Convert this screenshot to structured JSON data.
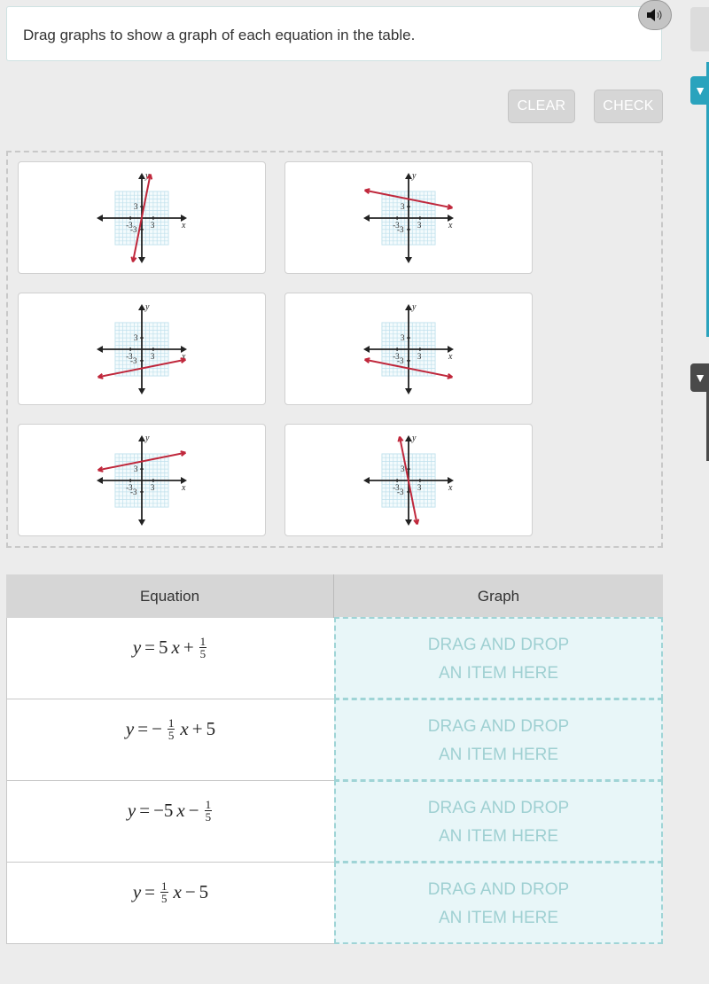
{
  "prompt": {
    "text": "Drag graphs to show a graph of each equation in the table.",
    "audio_icon": "speaker-icon"
  },
  "toolbar": {
    "clear_label": "CLEAR",
    "check_label": "CHECK"
  },
  "side_tabs": {
    "teal_icon": "▼",
    "dark_icon": "▼"
  },
  "colors": {
    "accent_teal": "#2aa3bd",
    "line_red": "#c0283c",
    "grid_blue": "#bfe0ec",
    "drop_bg": "#e8f6f8",
    "drop_text": "#9fd0d2"
  },
  "graph_axis": {
    "x_label": "x",
    "y_label": "y",
    "tick_pos": "3",
    "tick_neg": "-3"
  },
  "graph_cards": [
    {
      "id": "graph-1",
      "slope": 5,
      "intercept": 0.2
    },
    {
      "id": "graph-2",
      "slope": -0.2,
      "intercept": 5
    },
    {
      "id": "graph-3",
      "slope": 0.2,
      "intercept": -5
    },
    {
      "id": "graph-4",
      "slope": -0.2,
      "intercept": -5
    },
    {
      "id": "graph-5",
      "slope": 0.2,
      "intercept": 5
    },
    {
      "id": "graph-6",
      "slope": -5,
      "intercept": -0.2
    }
  ],
  "table": {
    "headers": [
      "Equation",
      "Graph"
    ],
    "rows": [
      {
        "lhs": "y",
        "eq": "=",
        "pre": "5",
        "var": "x",
        "op": "+",
        "frac_sign": "",
        "frac_num": "1",
        "frac_den": "5",
        "frac_first": false,
        "tail": ""
      },
      {
        "lhs": "y",
        "eq": "=",
        "pre": "−",
        "var": "x",
        "op": "+",
        "frac_num": "1",
        "frac_den": "5",
        "frac_first": true,
        "tail": "5"
      },
      {
        "lhs": "y",
        "eq": "=",
        "pre": "−5",
        "var": "x",
        "op": "−",
        "frac_num": "1",
        "frac_den": "5",
        "frac_first": false,
        "tail": ""
      },
      {
        "lhs": "y",
        "eq": "=",
        "pre": "",
        "var": "x",
        "op": "−",
        "frac_num": "1",
        "frac_den": "5",
        "frac_first": true,
        "tail": "5"
      }
    ],
    "drop_line1": "DRAG AND DROP",
    "drop_line2": "AN ITEM HERE"
  }
}
